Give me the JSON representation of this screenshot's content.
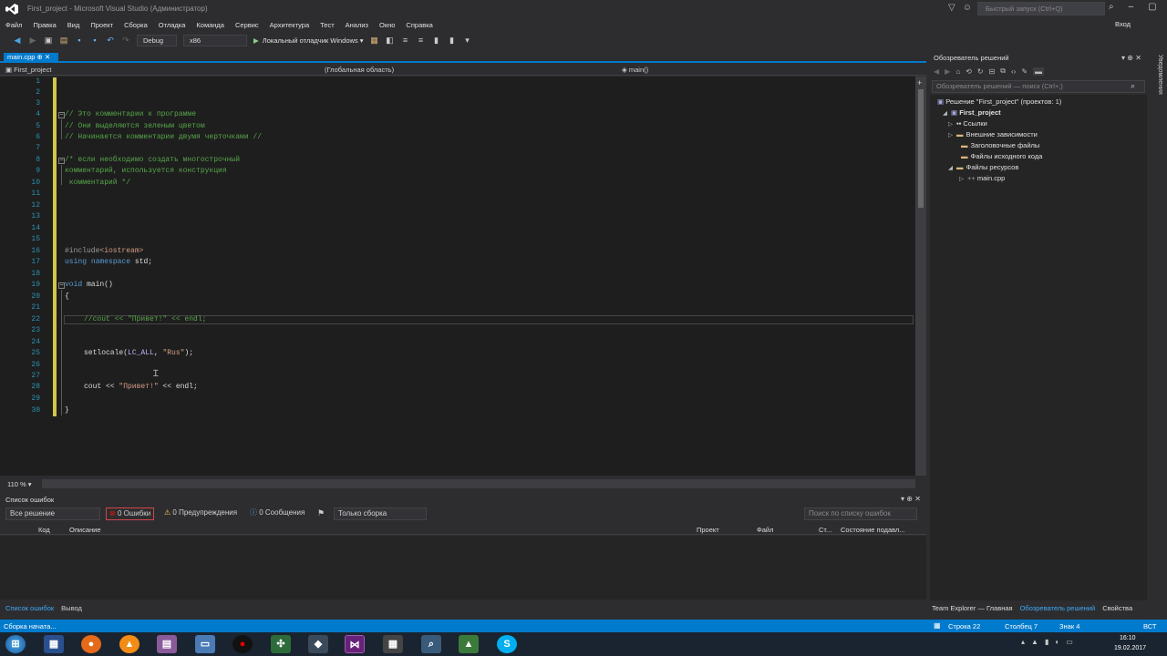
{
  "window": {
    "title": "First_project - Microsoft Visual Studio (Администратор)",
    "quick_launch_placeholder": "Быстрый запуск (Ctrl+Q)",
    "sign_in": "Вход"
  },
  "menu": [
    "Файл",
    "Правка",
    "Вид",
    "Проект",
    "Сборка",
    "Отладка",
    "Команда",
    "Сервис",
    "Архитектура",
    "Тест",
    "Анализ",
    "Окно",
    "Справка"
  ],
  "toolbar": {
    "config": "Debug",
    "platform": "x86",
    "debugger": "Локальный отладчик Windows"
  },
  "editor": {
    "tab": "main.cpp",
    "nav_project": "First_project",
    "nav_scope": "(Глобальная область)",
    "nav_member": "main()",
    "zoom": "110 %",
    "line_numbers": [
      "1",
      "2",
      "3",
      "4",
      "5",
      "6",
      "7",
      "8",
      "9",
      "10",
      "11",
      "12",
      "13",
      "14",
      "15",
      "16",
      "17",
      "18",
      "19",
      "20",
      "21",
      "22",
      "23",
      "24",
      "25",
      "26",
      "27",
      "28",
      "29",
      "30"
    ],
    "lines": {
      "l4": "// Это комментарии к программе",
      "l5": "// Они выделяются зеленым цветом",
      "l6": "// Начинается комментарии двумя черточками //",
      "l8": "/* если необходимо создать многострочный",
      "l9": "комментарий, используется конструкция",
      "l10": " комментарий */",
      "l16_pp": "#include",
      "l16_hdr": "<iostream>",
      "l17_kw1": "using",
      "l17_kw2": "namespace",
      "l17_rest": " std;",
      "l19_kw": "void",
      "l19_rest": " main()",
      "l20": "{",
      "l22": "//cout << \"Привет!\" << endl;",
      "l25_a": "setlocale(",
      "l25_mac": "LC_ALL",
      "l25_b": ", ",
      "l25_str": "\"Rus\"",
      "l25_c": ");",
      "l28_a": "cout << ",
      "l28_str": "\"Привет!\"",
      "l28_b": " << endl;",
      "l30": "}"
    }
  },
  "error_list": {
    "title": "Список ошибок",
    "scope": "Все решение",
    "errors": "0 Ошибки",
    "warnings": "0 Предупреждения",
    "messages": "0 Сообщения",
    "build_filter": "Только сборка",
    "search_placeholder": "Поиск по списку ошибок",
    "columns": [
      "Код",
      "Описание",
      "Проект",
      "Файл",
      "Ст...",
      "Состояние подавл..."
    ]
  },
  "bottom_tabs": [
    "Список ошибок",
    "Вывод"
  ],
  "solution_explorer": {
    "title": "Обозреватель решений",
    "search_placeholder": "Обозреватель решений — поиск (Ctrl+;)",
    "solution": "Решение \"First_project\" (проектов: 1)",
    "project": "First_project",
    "items": [
      "Ссылки",
      "Внешние зависимости",
      "Заголовочные файлы",
      "Файлы исходного кода",
      "Файлы ресурсов",
      "main.cpp"
    ],
    "bottom_tabs": [
      "Team Explorer — Главная",
      "Обозреватель решений",
      "Свойства"
    ],
    "side_tab": "Уведомления"
  },
  "status": {
    "left": "Сборка начата...",
    "line": "Строка 22",
    "col": "Столбец 7",
    "ch": "Знак 4",
    "mode": "ВСТ"
  },
  "taskbar": {
    "time": "16:10",
    "date": "19.02.2017",
    "apps": [
      "start-button",
      "file-manager",
      "firefox",
      "avast",
      "winrar",
      "notepad",
      "obs",
      "network",
      "media",
      "visual-studio",
      "calendar",
      "search-tool",
      "android-studio",
      "skype"
    ]
  },
  "colors": {
    "accent": "#007acc",
    "comment": "#57a64a",
    "keyword": "#569cd6",
    "line_number": "#2b91af",
    "string": "#d69d85"
  }
}
